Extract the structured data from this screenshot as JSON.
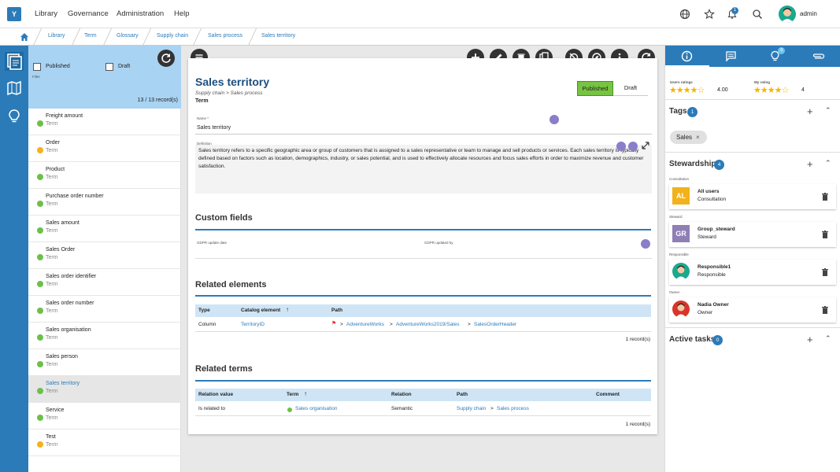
{
  "app": {
    "logo": "Y",
    "menu": [
      "Library",
      "Governance",
      "Administration",
      "Help"
    ],
    "user": "admin",
    "notifications": "1"
  },
  "breadcrumb": [
    "Library",
    "Term",
    "Glossary",
    "Supply chain",
    "Sales process",
    "Sales territory"
  ],
  "filter": {
    "published": "Published",
    "draft": "Draft",
    "filter_label": "Filter",
    "count": "13 / 13 record(s)"
  },
  "list": [
    {
      "name": "Freight amount",
      "type": "Term",
      "status": "green"
    },
    {
      "name": "Order",
      "type": "Term",
      "status": "yellow"
    },
    {
      "name": "Product",
      "type": "Term",
      "status": "green"
    },
    {
      "name": "Purchase order number",
      "type": "Term",
      "status": "green"
    },
    {
      "name": "Sales amount",
      "type": "Term",
      "status": "green"
    },
    {
      "name": "Sales Order",
      "type": "Term",
      "status": "green"
    },
    {
      "name": "Sales order identifier",
      "type": "Term",
      "status": "green"
    },
    {
      "name": "Sales order number",
      "type": "Term",
      "status": "green"
    },
    {
      "name": "Sales organisation",
      "type": "Term",
      "status": "green"
    },
    {
      "name": "Sales person",
      "type": "Term",
      "status": "green"
    },
    {
      "name": "Sales territory",
      "type": "Term",
      "status": "green",
      "selected": true
    },
    {
      "name": "Service",
      "type": "Term",
      "status": "green"
    },
    {
      "name": "Test",
      "type": "Term",
      "status": "yellow"
    }
  ],
  "detail": {
    "title": "Sales territory",
    "path": "Supply chain >  Sales process",
    "type": "Term",
    "status_published": "Published",
    "status_draft": "Draft",
    "name_label": "Name *",
    "name_value": "Sales territory",
    "definition_label": "Definition",
    "definition": "Sales territory refers to a specific geographic area or group of customers that is assigned to a sales representative or team to manage and sell products or services. Each sales territory is typically defined based on factors such as location, demographics, industry, or sales potential, and is used to effectively allocate resources and focus sales efforts in order to maximize revenue and customer satisfaction.",
    "custom_fields_title": "Custom fields",
    "gdpr_date_label": "GDPR update date",
    "gdpr_by_label": "GDPR updated by",
    "related_elements_title": "Related elements",
    "re_headers": [
      "Type",
      "Catalog element",
      "Path"
    ],
    "re_row": {
      "type": "Column",
      "element": "TerritoryID",
      "path": [
        "AdventureWorks",
        "AdventureWorks2019/Sales",
        "SalesOrderHeader"
      ]
    },
    "re_count": "1 record(s)",
    "related_terms_title": "Related terms",
    "rt_headers": [
      "Relation value",
      "Term",
      "Relation",
      "Path",
      "Comment"
    ],
    "rt_row": {
      "value": "Is related to",
      "term": "Sales organisation",
      "relation": "Semantic",
      "path": [
        "Supply chain",
        "Sales process"
      ]
    },
    "rt_count": "1 record(s)"
  },
  "right": {
    "tab_badge": "3",
    "users_ratings_label": "Users ratings",
    "users_rating": "4.00",
    "my_rating_label": "My rating",
    "my_rating": "4",
    "tags_title": "Tags",
    "tags_count": "1",
    "tag": "Sales",
    "stewardship_title": "Stewardship",
    "stewardship_count": "4",
    "stewards": [
      {
        "category": "Consultation",
        "initials": "AL",
        "name": "All users",
        "role": "Consultation",
        "color": "#f2b21b"
      },
      {
        "category": "Steward",
        "initials": "GR",
        "name": "Group_steward",
        "role": "Steward",
        "color": "#8e7fb5"
      },
      {
        "category": "Responsible",
        "initials": "",
        "name": "Responsible1",
        "role": "Responsible",
        "color": "#1aa88f"
      },
      {
        "category": "Owner",
        "initials": "",
        "name": "Nadia Owner",
        "role": "Owner",
        "color": "#d9342b"
      }
    ],
    "tasks_title": "Active tasks",
    "tasks_count": "0"
  }
}
